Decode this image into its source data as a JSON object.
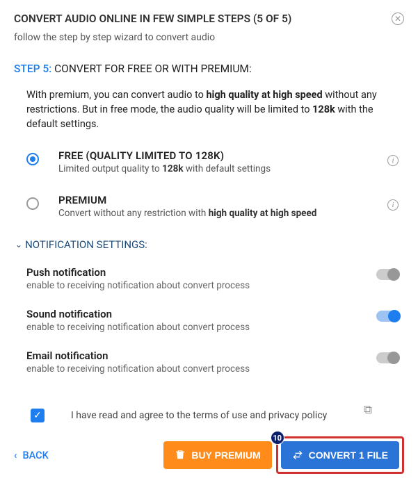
{
  "header": {
    "title": "CONVERT AUDIO ONLINE IN FEW SIMPLE STEPS (5 OF 5)",
    "subtitle": "follow the step by step wizard to convert audio"
  },
  "step": {
    "label": "STEP 5:",
    "text": " CONVERT FOR FREE OR WITH PREMIUM:"
  },
  "intro": {
    "p1a": "With premium, you can convert audio to ",
    "p1b": "high quality at high speed",
    "p1c": " without any restrictions. But in free mode, the audio quality will be limited to ",
    "p1d": "128k",
    "p1e": " with the default settings."
  },
  "options": {
    "free": {
      "title": "FREE (QUALITY LIMITED TO 128K)",
      "desc_a": "Limited output quality to ",
      "desc_b": "128k",
      "desc_c": " with default settings"
    },
    "premium": {
      "title": "PREMIUM",
      "desc_a": "Convert without any restriction with ",
      "desc_b": "high quality at high speed"
    }
  },
  "notif": {
    "header": "NOTIFICATION SETTINGS:",
    "push": {
      "title": "Push notification",
      "desc": "enable to receiving notification about convert process",
      "on": false
    },
    "sound": {
      "title": "Sound notification",
      "desc": "enable to receiving notification about convert process",
      "on": true
    },
    "email": {
      "title": "Email notification",
      "desc": "enable to receiving notification about convert process",
      "on": false
    }
  },
  "agree": {
    "text": "I have read and agree to the terms of use and privacy policy",
    "checked": true
  },
  "footer": {
    "back": "BACK",
    "buy": "BUY PREMIUM",
    "convert": "CONVERT 1 FILE",
    "badge": "10"
  }
}
